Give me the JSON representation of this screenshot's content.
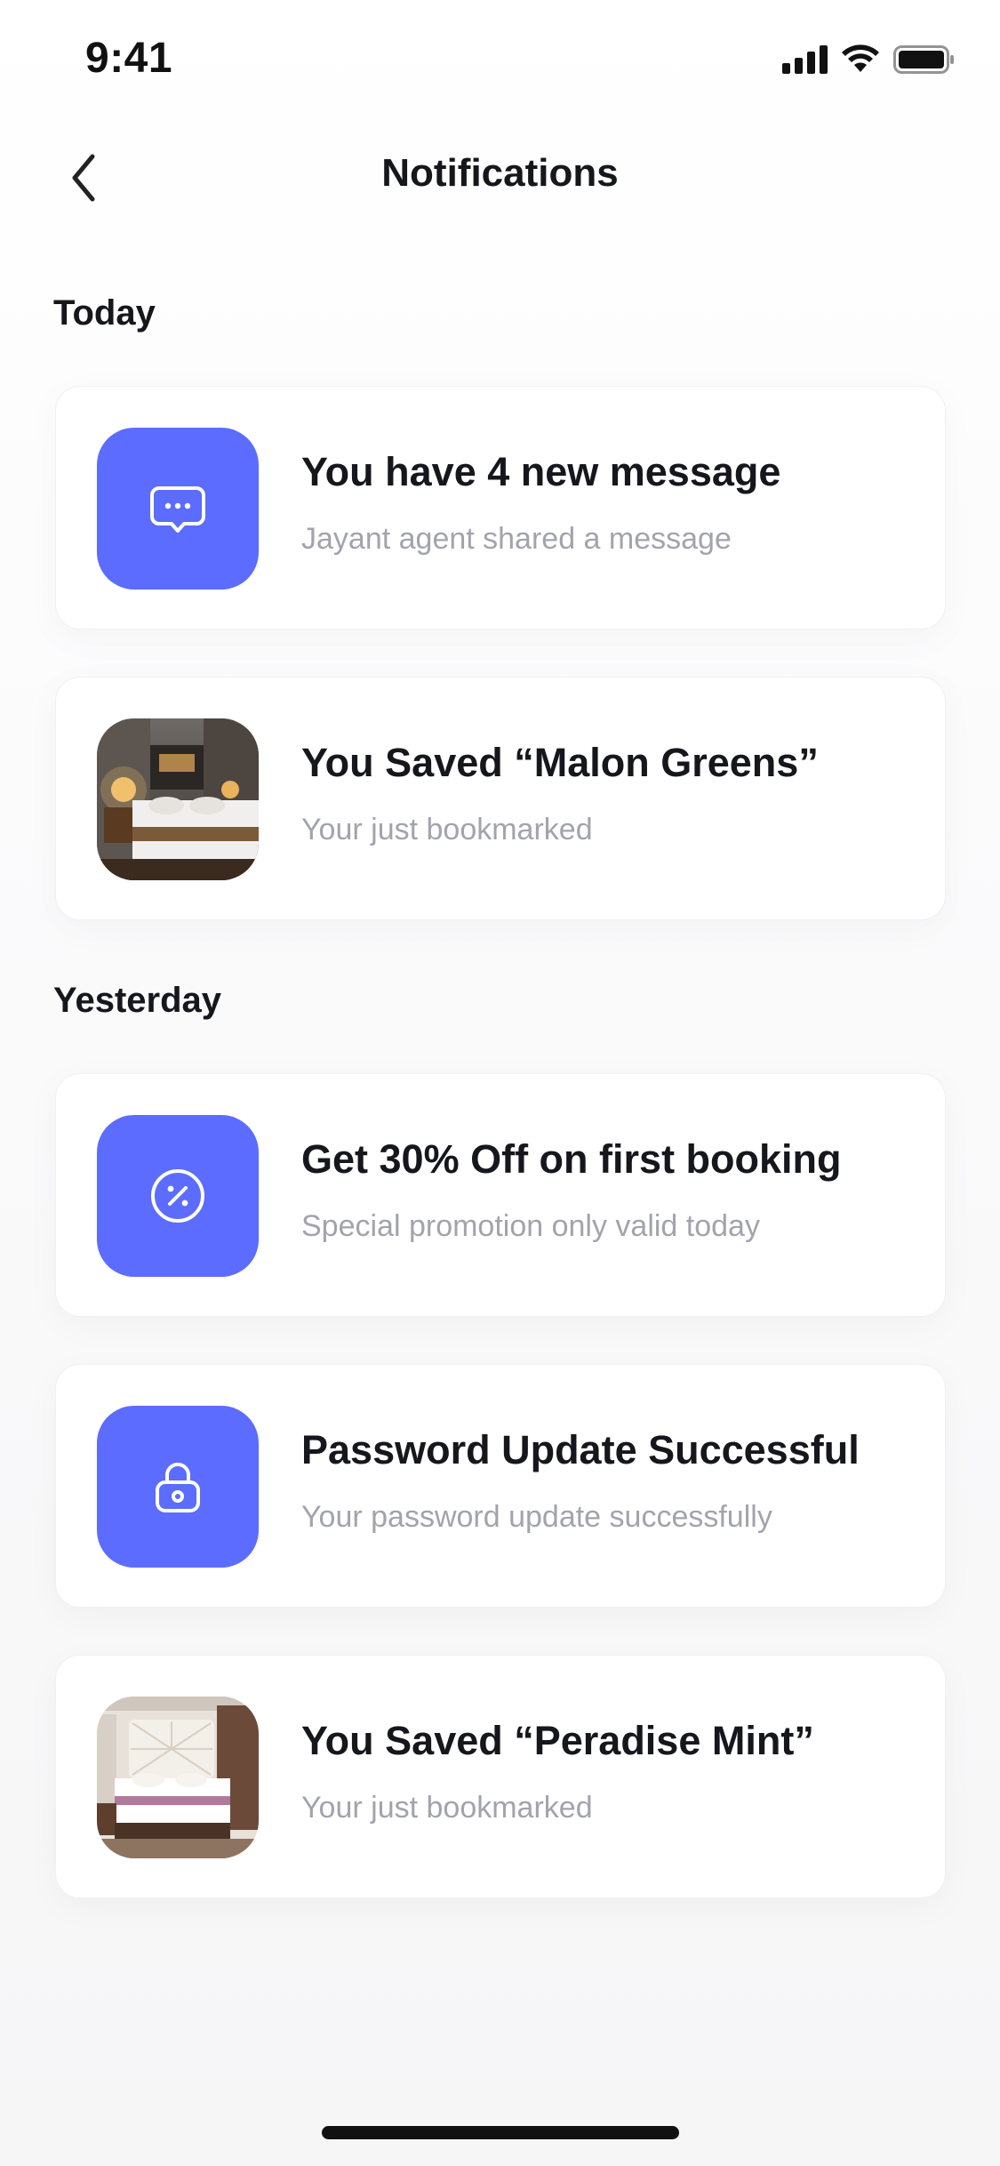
{
  "status_bar": {
    "time": "9:41",
    "icons": [
      "signal-icon",
      "wifi-icon",
      "battery-icon"
    ]
  },
  "header": {
    "title": "Notifications",
    "back_icon": "chevron-left-icon"
  },
  "sections": [
    {
      "label": "Today",
      "items": [
        {
          "title": "You have 4 new message",
          "subtitle": "Jayant agent shared a message",
          "icon": "chat-bubble-icon",
          "thumb_type": "icon"
        },
        {
          "title": "You Saved “Malon Greens”",
          "subtitle": "Your just bookmarked",
          "icon": "hotel-room-photo",
          "thumb_type": "photo"
        }
      ]
    },
    {
      "label": "Yesterday",
      "items": [
        {
          "title": "Get 30% Off on first booking",
          "subtitle": "Special promotion only valid today",
          "icon": "percent-badge-icon",
          "thumb_type": "icon"
        },
        {
          "title": "Password Update Successful",
          "subtitle": "Your password update successfully",
          "icon": "lock-icon",
          "thumb_type": "icon"
        },
        {
          "title": "You Saved “Peradise Mint”",
          "subtitle": "Your just bookmarked",
          "icon": "hotel-room-photo",
          "thumb_type": "photo"
        }
      ]
    }
  ],
  "colors": {
    "accent": "#5b6cff",
    "title_text": "#16161d",
    "subtitle_text": "#a3a3ad",
    "card_background": "#ffffff"
  }
}
